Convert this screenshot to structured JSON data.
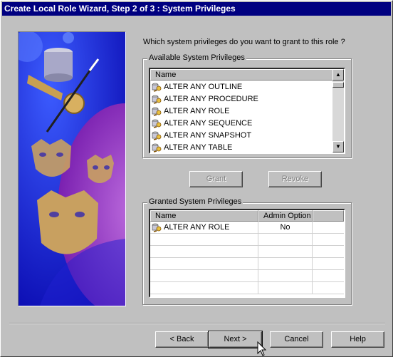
{
  "window": {
    "title": "Create Local Role Wizard, Step 2 of 3 : System Privileges"
  },
  "prompt": "Which system privileges do you want to grant to this role ?",
  "available": {
    "group_label": "Available System Privileges",
    "column_name": "Name",
    "items": [
      "ALTER ANY OUTLINE",
      "ALTER ANY PROCEDURE",
      "ALTER ANY ROLE",
      "ALTER ANY SEQUENCE",
      "ALTER ANY SNAPSHOT",
      "ALTER ANY TABLE"
    ]
  },
  "actions": {
    "grant_label": "Grant",
    "revoke_label": "Revoke"
  },
  "granted": {
    "group_label": "Granted System Privileges",
    "columns": {
      "name": "Name",
      "admin": "Admin Option"
    },
    "rows": [
      {
        "name": "ALTER ANY ROLE",
        "admin": "No"
      }
    ]
  },
  "nav": {
    "back_label": "< Back",
    "next_label": "Next >",
    "cancel_label": "Cancel",
    "help_label": "Help"
  },
  "icons": {
    "privilege": "privilege-key-icon",
    "scroll_up": "scroll-up-arrow-icon",
    "scroll_down": "scroll-down-arrow-icon",
    "cursor": "mouse-pointer-icon"
  },
  "colors": {
    "titlebar": "#000080",
    "dialog": "#c0c0c0",
    "artwork_background": "#1010c8"
  }
}
